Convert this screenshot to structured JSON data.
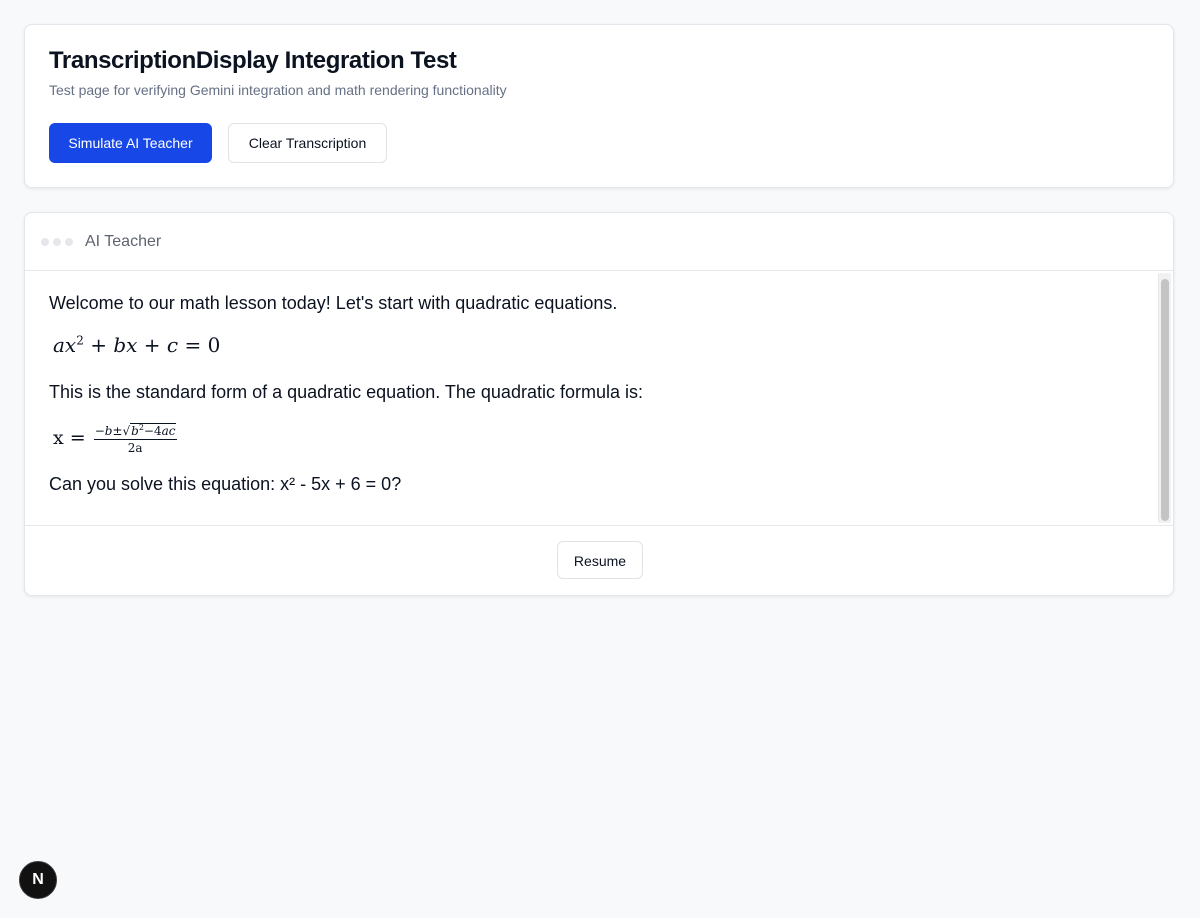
{
  "header": {
    "title": "TranscriptionDisplay Integration Test",
    "subtitle": "Test page for verifying Gemini integration and math rendering functionality",
    "buttons": {
      "simulate_label": "Simulate AI Teacher",
      "clear_label": "Clear Transcription"
    }
  },
  "transcript": {
    "speaker": "AI Teacher",
    "lines": [
      "Welcome to our math lesson today! Let's start with quadratic equations.",
      "This is the standard form of a quadratic equation. The quadratic formula is:",
      "Can you solve this equation: x² - 5x + 6 = 0?"
    ],
    "equations": {
      "standard_form": "ax² + bx + c = 0",
      "formula_lhs": "x =",
      "formula_numerator": "−b±√b²−4ac",
      "formula_denominator": "2a"
    },
    "resume_label": "Resume"
  },
  "footer": {
    "badge_letter": "N"
  },
  "colors": {
    "primary": "#1747e6",
    "background": "#f8f9fb",
    "text": "#0b1220",
    "muted": "#667085",
    "border": "#e3e6ea"
  },
  "icons": {
    "loading_dots": "three-dots-icon",
    "next_badge": "nextjs-logo-icon"
  }
}
